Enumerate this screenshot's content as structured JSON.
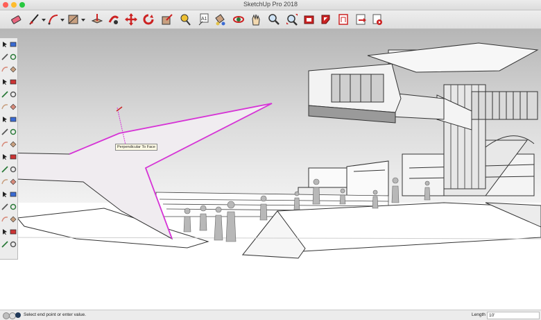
{
  "window": {
    "title": "SketchUp Pro 2018",
    "traffic_lights": {
      "close": "#ff5f57",
      "minimize": "#febc2e",
      "zoom": "#28c840"
    }
  },
  "toolbar": {
    "tools": [
      "eraser-tool",
      "line-tool",
      "arc-tool",
      "shape-tool",
      "push-pull-tool",
      "follow-me-tool",
      "move-tool",
      "rotate-tool",
      "scale-tool",
      "tape-measure-tool",
      "text-tool",
      "paint-bucket-tool",
      "orbit-tool",
      "pan-tool",
      "zoom-tool",
      "zoom-extents-tool",
      "warehouse-tool",
      "extension-warehouse-tool",
      "layout-tool",
      "share-model-tool",
      "preview-model-tool"
    ],
    "text_tool_glyph": "A1"
  },
  "palette": {
    "tools": [
      "select-tool",
      "component-tool",
      "eraser-tool",
      "paint-tool",
      "line-tool",
      "freehand-tool",
      "rectangle-tool",
      "rotated-rectangle-tool",
      "circle-tool",
      "polygon-tool",
      "arc-tool",
      "pie-tool",
      "move-tool",
      "push-pull-tool",
      "rotate-tool",
      "follow-me-tool",
      "scale-tool",
      "offset-tool",
      "tape-tool",
      "dimension-tool",
      "protractor-tool",
      "text-tool",
      "axes-tool",
      "3d-text-tool",
      "orbit-tool",
      "pan-tool",
      "zoom-tool",
      "zoom-window-tool",
      "zoom-extents-tool",
      "previous-tool",
      "position-camera-tool",
      "walk-tool",
      "look-around-tool",
      "section-plane-tool"
    ]
  },
  "viewport": {
    "inference_tooltip": "Perpendicular To Face",
    "highlight_color": "#d633d6"
  },
  "status": {
    "message": "Select end point or enter value.",
    "length_label": "Length",
    "length_value": "10'"
  }
}
